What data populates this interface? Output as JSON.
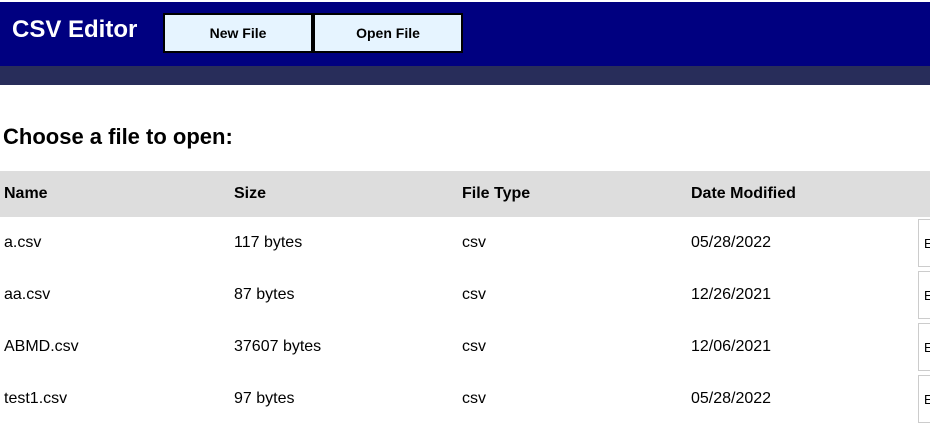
{
  "header": {
    "app_title": "CSV Editor",
    "new_file_label": "New File",
    "open_file_label": "Open File"
  },
  "main": {
    "title": "Choose a file to open:"
  },
  "table": {
    "columns": [
      "Name",
      "Size",
      "File Type",
      "Date Modified"
    ],
    "rows": [
      {
        "name": "a.csv",
        "size": "117 bytes",
        "type": "csv",
        "modified": "05/28/2022",
        "action": "E"
      },
      {
        "name": "aa.csv",
        "size": "87 bytes",
        "type": "csv",
        "modified": "12/26/2021",
        "action": "E"
      },
      {
        "name": "ABMD.csv",
        "size": "37607 bytes",
        "type": "csv",
        "modified": "12/06/2021",
        "action": "E"
      },
      {
        "name": "test1.csv",
        "size": "97 bytes",
        "type": "csv",
        "modified": "05/28/2022",
        "action": "E"
      }
    ]
  },
  "colors": {
    "header_bg": "#000080",
    "subbar_bg": "#282d5a",
    "button_bg": "#e6f4ff",
    "table_header_bg": "#dddddd"
  }
}
